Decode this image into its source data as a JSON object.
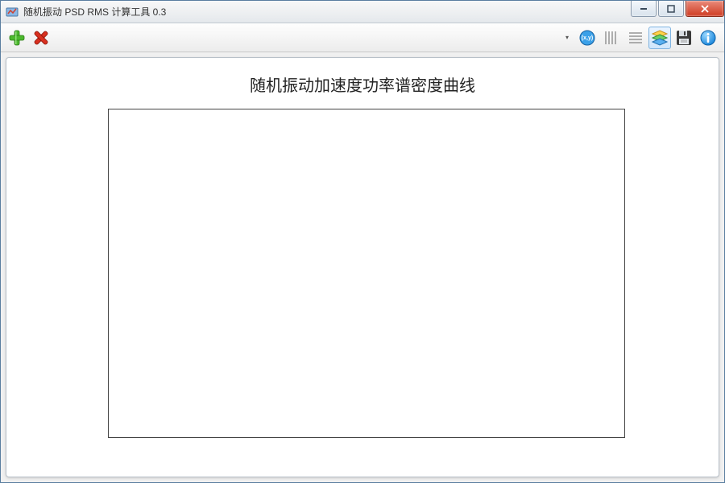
{
  "window": {
    "title": "随机振动 PSD RMS 计算工具 0.3"
  },
  "toolbar": {
    "add_label": "Add",
    "remove_label": "Remove",
    "xy_label": "XY",
    "grid_vertical_label": "Vertical Grid",
    "grid_horizontal_label": "Horizontal Grid",
    "layers_label": "Layers",
    "save_label": "Save",
    "info_label": "Info"
  },
  "chart": {
    "title": "随机振动加速度功率谱密度曲线"
  },
  "chart_data": {
    "type": "line",
    "title": "随机振动加速度功率谱密度曲线",
    "xlabel": "",
    "ylabel": "",
    "series": [],
    "x": [],
    "xlim": null,
    "ylim": null
  }
}
